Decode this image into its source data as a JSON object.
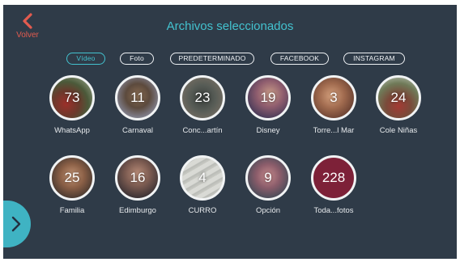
{
  "header": {
    "back_label": "Volver",
    "back_icon": "chevron-left-icon",
    "title": "Archivos seleccionados"
  },
  "filters": [
    {
      "label": "Vídeo",
      "active": true
    },
    {
      "label": "Foto",
      "active": false
    },
    {
      "label": "PREDETERMINADO",
      "active": false
    },
    {
      "label": "FACEBOOK",
      "active": false
    },
    {
      "label": "INSTAGRAM",
      "active": false
    }
  ],
  "albums": [
    {
      "count": "73",
      "name": "WhatsApp"
    },
    {
      "count": "11",
      "name": "Carnaval"
    },
    {
      "count": "23",
      "name": "Conc...artín"
    },
    {
      "count": "19",
      "name": "Disney"
    },
    {
      "count": "3",
      "name": "Torre...l Mar"
    },
    {
      "count": "24",
      "name": "Cole Niñas"
    },
    {
      "count": "25",
      "name": "Familia"
    },
    {
      "count": "16",
      "name": "Edimburgo"
    },
    {
      "count": "4",
      "name": "CURRO"
    },
    {
      "count": "9",
      "name": "Opción"
    },
    {
      "count": "228",
      "name": "Toda...fotos"
    }
  ],
  "next_icon": "chevron-right-icon",
  "colors": {
    "background": "#2f3b48",
    "accent": "#43c2cf",
    "back_accent": "#e35b4f",
    "highlight_album": "#7d2138"
  }
}
